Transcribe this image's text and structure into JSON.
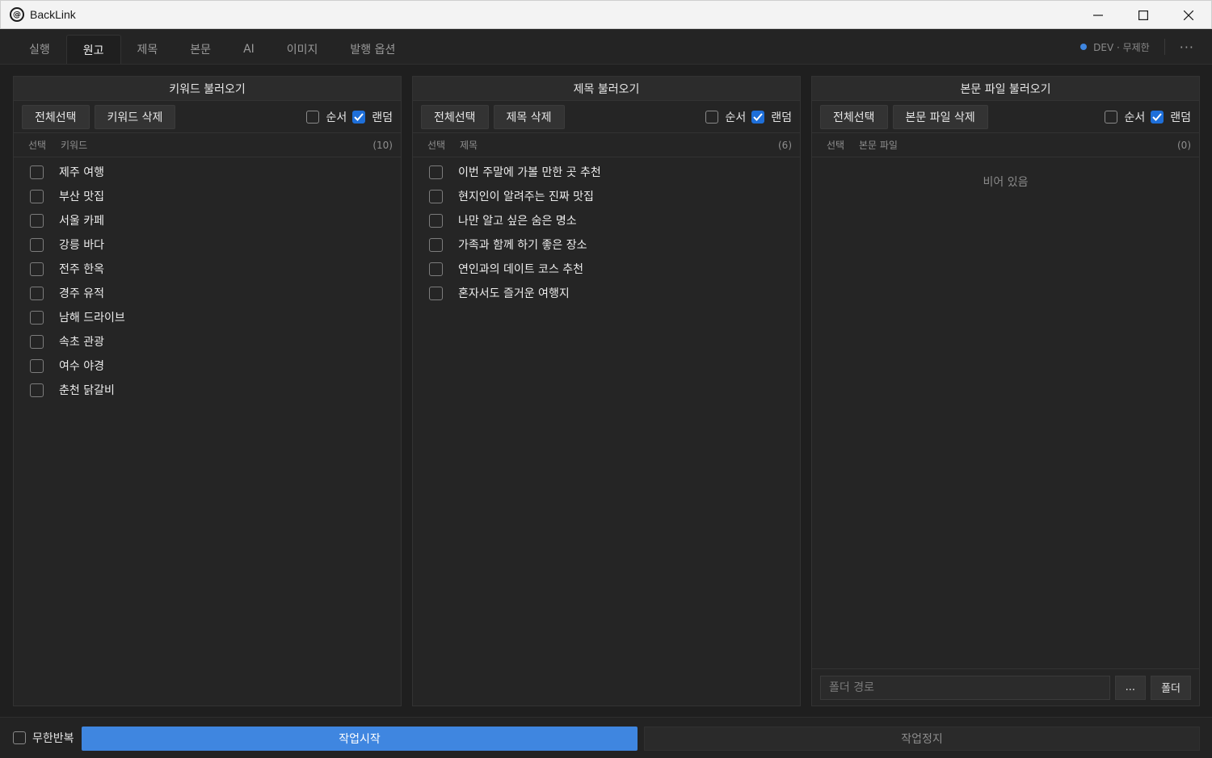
{
  "window": {
    "title": "BackLink",
    "icon": "backlink-logo-icon"
  },
  "tabs": [
    {
      "label": "실행",
      "active": false
    },
    {
      "label": "원고",
      "active": true
    },
    {
      "label": "제목",
      "active": false
    },
    {
      "label": "본문",
      "active": false
    },
    {
      "label": "AI",
      "active": false
    },
    {
      "label": "이미지",
      "active": false
    },
    {
      "label": "발행 옵션",
      "active": false
    }
  ],
  "status": {
    "label": "DEV · 무제한",
    "dot_color": "#3f86e0",
    "more": "···"
  },
  "panels": {
    "keyword": {
      "title": "키워드 불러오기",
      "select_all": "전체선택",
      "delete": "키워드 삭제",
      "order_label": "순서",
      "order_checked": false,
      "random_label": "랜덤",
      "random_checked": true,
      "col_select": "선택",
      "col_name": "키워드",
      "count": "(10)",
      "items": [
        "제주 여행",
        "부산 맛집",
        "서울 카페",
        "강릉 바다",
        "전주 한옥",
        "경주 유적",
        "남해 드라이브",
        "속초 관광",
        "여수 야경",
        "춘천 닭갈비"
      ]
    },
    "title": {
      "title": "제목 불러오기",
      "select_all": "전체선택",
      "delete": "제목 삭제",
      "order_label": "순서",
      "order_checked": false,
      "random_label": "랜덤",
      "random_checked": true,
      "col_select": "선택",
      "col_name": "제목",
      "count": "(6)",
      "items": [
        "이번 주말에 가볼 만한 곳 추천",
        "현지인이 알려주는 진짜 맛집",
        "나만 알고 싶은 숨은 명소",
        "가족과 함께 하기 좋은 장소",
        "연인과의 데이트 코스 추천",
        "혼자서도 즐거운 여행지"
      ]
    },
    "body": {
      "title": "본문 파일 불러오기",
      "select_all": "전체선택",
      "delete": "본문 파일 삭제",
      "order_label": "순서",
      "order_checked": false,
      "random_label": "랜덤",
      "random_checked": true,
      "col_select": "선택",
      "col_name": "본문 파일",
      "count": "(0)",
      "empty_text": "비어 있음",
      "folder_placeholder": "폴더 경로",
      "browse_label": "...",
      "folder_button": "폴더"
    }
  },
  "bottom": {
    "loop_label": "무한반복",
    "loop_checked": false,
    "start_label": "작업시작",
    "stop_label": "작업정지",
    "accent": "#3f86e0"
  }
}
